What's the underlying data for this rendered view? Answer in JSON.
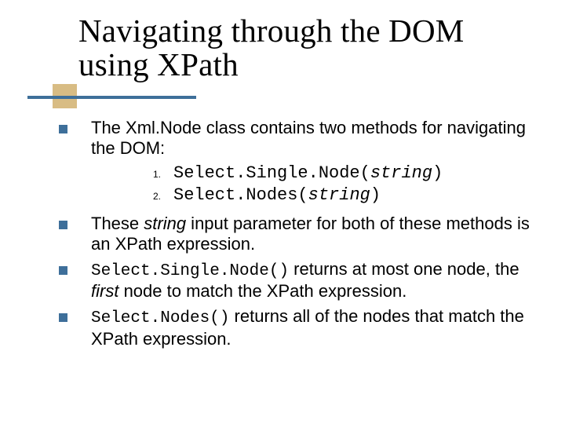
{
  "title": "Navigating through the DOM using XPath",
  "bullets": {
    "b1": "The Xml.Node class contains two methods for navigating the DOM:",
    "sub": {
      "n1": "1.",
      "n2": "2.",
      "m1a": "Select.Single.Node(",
      "m1b": "string",
      "m1c": ")",
      "m2a": "Select.Nodes(",
      "m2b": "string",
      "m2c": ")"
    },
    "b2a": "These ",
    "b2b": "string",
    "b2c": " input parameter for both of these methods is an XPath expression.",
    "b3a": "Select.Single.Node()",
    "b3b": " returns at most one node, the ",
    "b3c": "first",
    "b3d": " node to match the XPath expression.",
    "b4a": "Select.Nodes()",
    "b4b": " returns all of the nodes that match the XPath expression."
  }
}
